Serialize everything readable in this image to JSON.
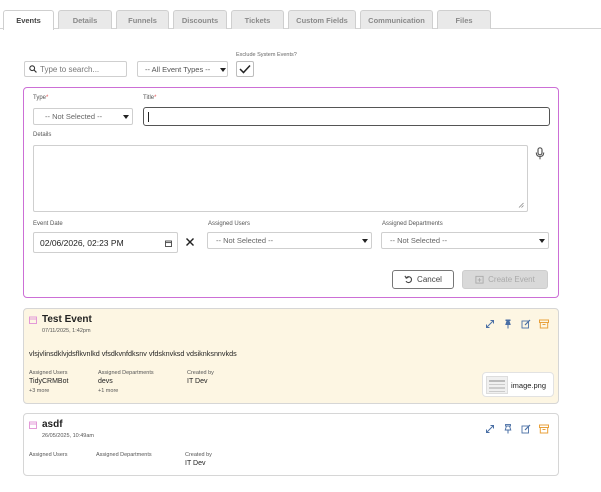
{
  "tabs": [
    {
      "label": "Events"
    },
    {
      "label": "Details"
    },
    {
      "label": "Funnels"
    },
    {
      "label": "Discounts"
    },
    {
      "label": "Tickets"
    },
    {
      "label": "Custom Fields"
    },
    {
      "label": "Communication"
    },
    {
      "label": "Files"
    }
  ],
  "filters": {
    "search_placeholder": "Type to search...",
    "event_types_value": "-- All Event Types --",
    "exclude_label": "Exclude System Events?",
    "exclude_checked": true
  },
  "form": {
    "type_label": "Type",
    "type_value": "-- Not Selected --",
    "title_label": "Title",
    "title_value": "",
    "details_label": "Details",
    "event_date_label": "Event Date",
    "event_date_value": "02/06/2026, 02:23 PM",
    "assigned_users_label": "Assigned Users",
    "assigned_users_value": "-- Not Selected --",
    "assigned_departments_label": "Assigned Departments",
    "assigned_departments_value": "-- Not Selected --",
    "cancel_label": "Cancel",
    "create_label": "Create Event"
  },
  "events": [
    {
      "title": "Test Event",
      "date": "07/11/2025, 1:42pm",
      "body": "vlsjvlinsdklvjdsflkvnlkd vfsdkvnfdksnv vfdsknvksd vdsiknksnnvkds",
      "assigned_users_label": "Assigned Users",
      "assigned_users": "TidyCRMBot",
      "assigned_users_more": "+3 more",
      "assigned_departments_label": "Assigned Departments",
      "assigned_departments": "devs",
      "assigned_departments_more": "+1 more",
      "created_by_label": "Created by",
      "created_by": "IT Dev",
      "attachment": "image.png"
    },
    {
      "title": "asdf",
      "date": "26/05/2025, 10:49am",
      "assigned_users_label": "Assigned Users",
      "assigned_departments_label": "Assigned Departments",
      "created_by_label": "Created by",
      "created_by": "IT Dev"
    }
  ],
  "colors": {
    "accent": "#cc6fd6",
    "card_highlight": "#fdf6e3",
    "action_orange": "#e9a13b",
    "action_blue": "#4a6fa5"
  }
}
